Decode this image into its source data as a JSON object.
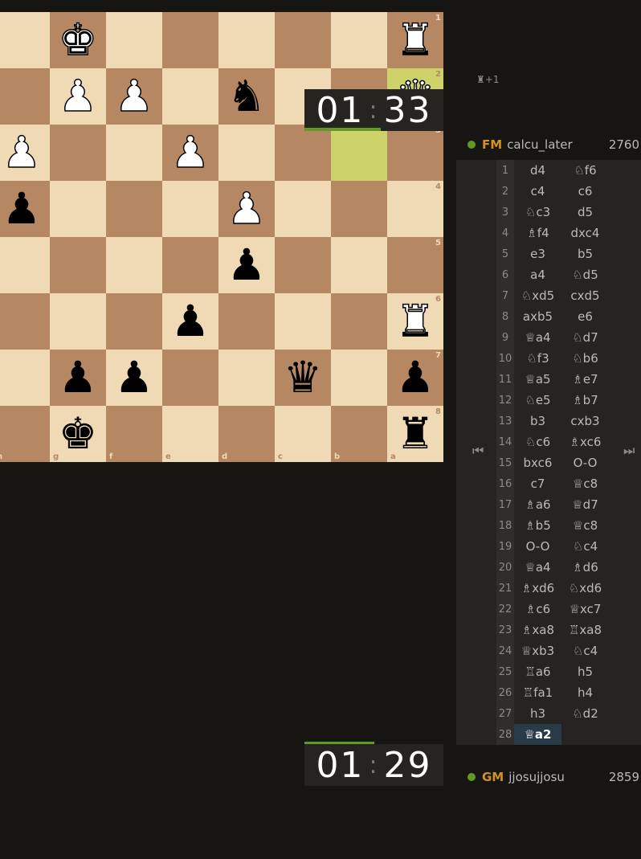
{
  "board": {
    "files": [
      "h",
      "g",
      "f",
      "e",
      "d",
      "c",
      "b",
      "a"
    ],
    "ranks": [
      "1",
      "2",
      "3",
      "4",
      "5",
      "6",
      "7",
      "8"
    ],
    "highlight": [
      "b3",
      "a2"
    ],
    "pieces": [
      {
        "square": "g1",
        "piece": "♚",
        "color": "w",
        "name": "white-king-icon"
      },
      {
        "square": "a1",
        "piece": "♜",
        "color": "w",
        "name": "white-rook-icon"
      },
      {
        "square": "g2",
        "piece": "♟",
        "color": "w",
        "name": "white-pawn-icon"
      },
      {
        "square": "f2",
        "piece": "♟",
        "color": "w",
        "name": "white-pawn-icon"
      },
      {
        "square": "d2",
        "piece": "♞",
        "color": "b",
        "name": "black-knight-icon"
      },
      {
        "square": "a2",
        "piece": "♛",
        "color": "w",
        "name": "white-queen-icon"
      },
      {
        "square": "h3",
        "piece": "♟",
        "color": "w",
        "name": "white-pawn-icon"
      },
      {
        "square": "e3",
        "piece": "♟",
        "color": "w",
        "name": "white-pawn-icon"
      },
      {
        "square": "h4",
        "piece": "♟",
        "color": "b",
        "name": "black-pawn-icon"
      },
      {
        "square": "d4",
        "piece": "♟",
        "color": "w",
        "name": "white-pawn-icon"
      },
      {
        "square": "d5",
        "piece": "♟",
        "color": "b",
        "name": "black-pawn-icon"
      },
      {
        "square": "e6",
        "piece": "♟",
        "color": "b",
        "name": "black-pawn-icon"
      },
      {
        "square": "a6",
        "piece": "♜",
        "color": "w",
        "name": "white-rook-icon"
      },
      {
        "square": "g7",
        "piece": "♟",
        "color": "b",
        "name": "black-pawn-icon"
      },
      {
        "square": "f7",
        "piece": "♟",
        "color": "b",
        "name": "black-pawn-icon"
      },
      {
        "square": "c7",
        "piece": "♛",
        "color": "b",
        "name": "black-queen-icon"
      },
      {
        "square": "a7",
        "piece": "♟",
        "color": "b",
        "name": "black-pawn-icon"
      },
      {
        "square": "g8",
        "piece": "♚",
        "color": "b",
        "name": "black-king-icon"
      },
      {
        "square": "a8",
        "piece": "♜",
        "color": "b",
        "name": "black-rook-icon"
      }
    ]
  },
  "material": {
    "icon": "♜",
    "text": "+1"
  },
  "clock_top": {
    "minutes": "01",
    "sep": ":",
    "seconds": "33",
    "progress": 0.55
  },
  "clock_bottom": {
    "minutes": "01",
    "sep": ":",
    "seconds": "29",
    "progress": 0.5
  },
  "player_top": {
    "title": "FM",
    "name": "calcu_later",
    "rating": "2760"
  },
  "player_bottom": {
    "title": "GM",
    "name": "jjosujjosu",
    "rating": "2859"
  },
  "nav": {
    "first": "⏮",
    "last": "⏭"
  },
  "moves": [
    {
      "n": "1",
      "w": "d4",
      "b": "♘f6"
    },
    {
      "n": "2",
      "w": "c4",
      "b": "c6"
    },
    {
      "n": "3",
      "w": "♘c3",
      "b": "d5"
    },
    {
      "n": "4",
      "w": "♗f4",
      "b": "dxc4"
    },
    {
      "n": "5",
      "w": "e3",
      "b": "b5"
    },
    {
      "n": "6",
      "w": "a4",
      "b": "♘d5"
    },
    {
      "n": "7",
      "w": "♘xd5",
      "b": "cxd5"
    },
    {
      "n": "8",
      "w": "axb5",
      "b": "e6"
    },
    {
      "n": "9",
      "w": "♕a4",
      "b": "♘d7"
    },
    {
      "n": "10",
      "w": "♘f3",
      "b": "♘b6"
    },
    {
      "n": "11",
      "w": "♕a5",
      "b": "♗e7"
    },
    {
      "n": "12",
      "w": "♘e5",
      "b": "♗b7"
    },
    {
      "n": "13",
      "w": "b3",
      "b": "cxb3"
    },
    {
      "n": "14",
      "w": "♘c6",
      "b": "♗xc6"
    },
    {
      "n": "15",
      "w": "bxc6",
      "b": "O-O"
    },
    {
      "n": "16",
      "w": "c7",
      "b": "♕c8"
    },
    {
      "n": "17",
      "w": "♗a6",
      "b": "♕d7"
    },
    {
      "n": "18",
      "w": "♗b5",
      "b": "♕c8"
    },
    {
      "n": "19",
      "w": "O-O",
      "b": "♘c4"
    },
    {
      "n": "20",
      "w": "♕a4",
      "b": "♗d6"
    },
    {
      "n": "21",
      "w": "♗xd6",
      "b": "♘xd6"
    },
    {
      "n": "22",
      "w": "♗c6",
      "b": "♕xc7"
    },
    {
      "n": "23",
      "w": "♗xa8",
      "b": "♖xa8"
    },
    {
      "n": "24",
      "w": "♕xb3",
      "b": "♘c4"
    },
    {
      "n": "25",
      "w": "♖a6",
      "b": "h5"
    },
    {
      "n": "26",
      "w": "♖fa1",
      "b": "h4"
    },
    {
      "n": "27",
      "w": "h3",
      "b": "♘d2"
    },
    {
      "n": "28",
      "w": "♕a2",
      "b": ""
    }
  ]
}
